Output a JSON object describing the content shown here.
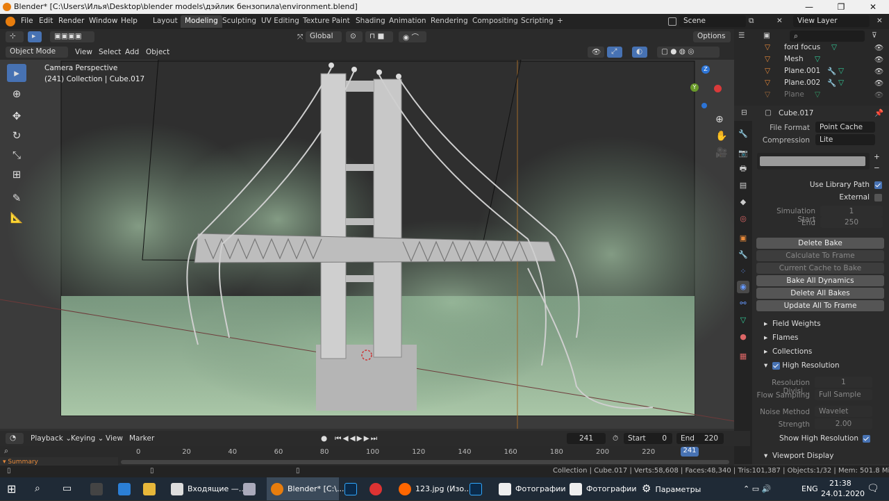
{
  "titlebar": {
    "title": "Blender* [C:\\Users\\Илья\\Desktop\\blender models\\дэйлик бензопила\\environment.blend]",
    "minimize": "—",
    "maximize": "❐",
    "close": "✕"
  },
  "menus": [
    "File",
    "Edit",
    "Render",
    "Window",
    "Help"
  ],
  "workspaces": [
    "Layout",
    "Modeling",
    "Sculpting",
    "UV Editing",
    "Texture Paint",
    "Shading",
    "Animation",
    "Rendering",
    "Compositing",
    "Scripting"
  ],
  "active_workspace": "Modeling",
  "scene": "Scene",
  "view_layer": "View Layer",
  "header3d": {
    "transform": "Global",
    "options": "Options"
  },
  "header2": {
    "mode": "Object Mode",
    "view": "View",
    "select": "Select",
    "add": "Add",
    "object": "Object"
  },
  "viewport": {
    "overlay_line1": "Camera Perspective",
    "overlay_line2": "(241) Collection | Cube.017",
    "axis_z": "Z",
    "axis_y": "Y"
  },
  "outliner": {
    "items": [
      {
        "name": "ford focus"
      },
      {
        "name": "Mesh"
      },
      {
        "name": "Plane.001"
      },
      {
        "name": "Plane.002"
      },
      {
        "name": "Plane"
      }
    ]
  },
  "properties": {
    "object_name": "Cube.017",
    "file_format_label": "File Format",
    "file_format": "Point Cache",
    "compression_label": "Compression",
    "compression": "Lite",
    "use_library_path": "Use Library Path",
    "external": "External",
    "sim_start_label": "Simulation Start",
    "sim_start": "1",
    "end_label": "End",
    "end": "250",
    "buttons": [
      "Delete Bake",
      "Calculate To Frame",
      "Current Cache to Bake",
      "Bake All Dynamics",
      "Delete All Bakes",
      "Update All To Frame"
    ],
    "sections": [
      "Field Weights",
      "Flames",
      "Collections",
      "High Resolution"
    ],
    "res_div_label": "Resolution Divisi...",
    "res_div": "1",
    "flow_label": "Flow Sampling",
    "flow": "Full Sample",
    "noise_label": "Noise Method",
    "noise": "Wavelet",
    "strength_label": "Strength",
    "strength": "2.00",
    "show_hires": "Show High Resolution",
    "viewport_display": "Viewport Display"
  },
  "timeline": {
    "playback": "Playback",
    "keying": "Keying",
    "view": "View",
    "marker": "Marker",
    "current": "241",
    "start_label": "Start",
    "start": "0",
    "end_label": "End",
    "end": "220",
    "ticks": [
      "0",
      "20",
      "40",
      "60",
      "80",
      "100",
      "120",
      "140",
      "160",
      "180",
      "200",
      "220"
    ],
    "current_marker": "241",
    "summary": "Summary"
  },
  "status": "Collection | Cube.017 | Verts:58,608 | Faces:48,340 | Tris:101,387 | Objects:1/32 | Mem: 501.8 MiB | v2.81.16",
  "taskbar": {
    "apps": [
      {
        "label": "Входящие —..."
      },
      {
        "label": "Blender* [C:\\..."
      },
      {
        "label": "123.jpg (Изо..."
      },
      {
        "label": "Фотографии"
      },
      {
        "label": "Фотографии"
      },
      {
        "label": "Параметры"
      }
    ],
    "lang": "ENG",
    "time": "21:38",
    "date": "24.01.2020"
  }
}
